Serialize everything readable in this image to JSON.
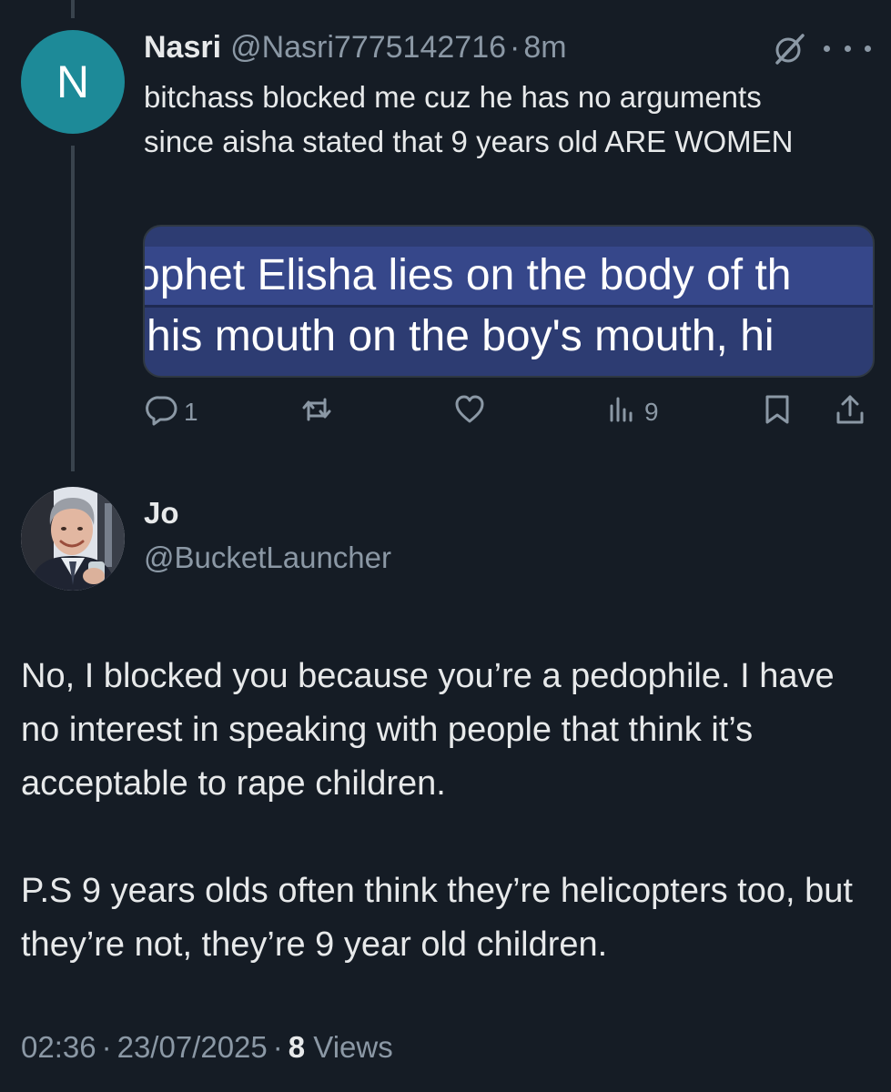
{
  "reply_tweet": {
    "avatar_letter": "N",
    "display_name": "Nasri",
    "handle": "@Nasri7775142716",
    "separator": "·",
    "time": "8m",
    "text": "bitchass blocked me cuz he has no arguments since aisha stated that 9 years old ARE WOMEN",
    "media": {
      "line1": "ophet Elisha lies on the body of th",
      "line2": "his mouth on the boy's mouth, hi"
    },
    "actions": {
      "reply_count": "1",
      "repost_count": "",
      "like_count": "",
      "views_count": "9"
    },
    "icons": [
      "grok-icon",
      "more-icon",
      "reply-icon",
      "repost-icon",
      "like-icon",
      "views-icon",
      "bookmark-icon",
      "share-icon"
    ]
  },
  "main_tweet": {
    "display_name": "Jo",
    "handle": "@BucketLauncher",
    "paragraph1": "No, I blocked you because you’re a pedophile. I have no interest in speaking with people that think it’s acceptable to rape children.",
    "paragraph2": "P.S 9 years olds often think they’re helicopters too, but they’re not, they’re 9 year old children.",
    "time": "02:36",
    "separator": "·",
    "date": "23/07/2025",
    "views_count": "8",
    "views_label": "Views"
  },
  "colors": {
    "background": "#151c25",
    "text_primary": "#e7e9ea",
    "text_secondary": "#8b98a5",
    "avatar_n": "#1d8a98",
    "thread_line": "#39434d"
  }
}
